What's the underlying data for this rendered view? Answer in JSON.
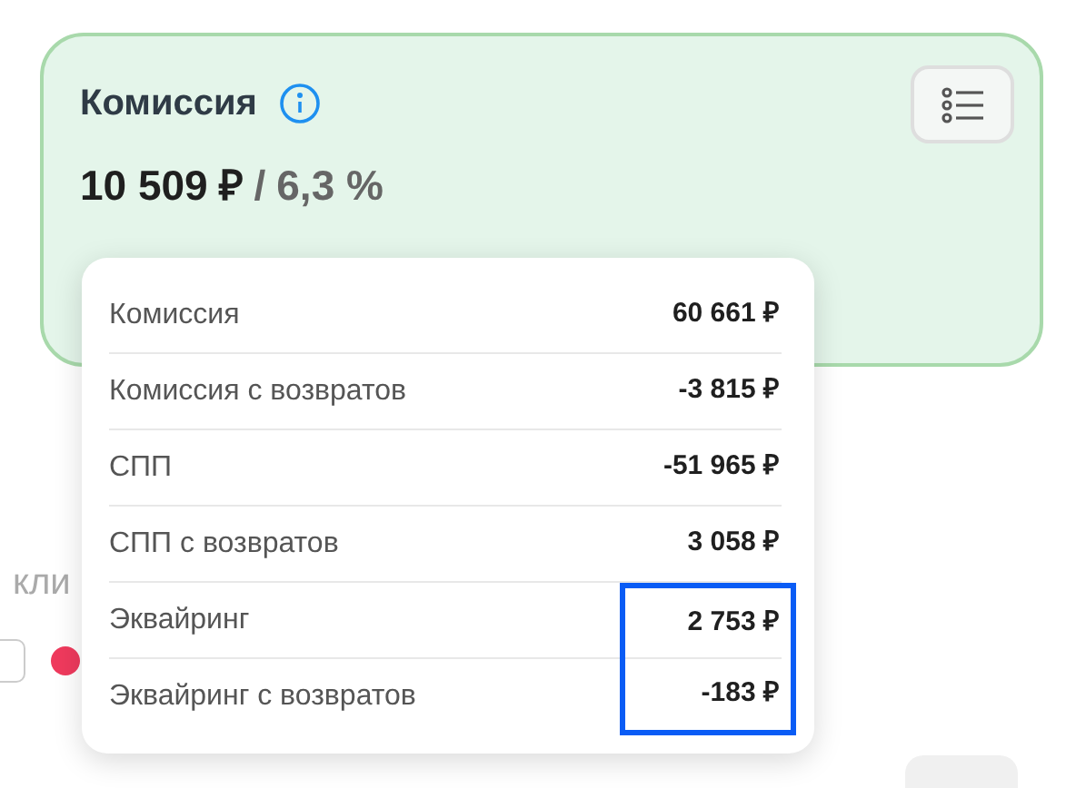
{
  "card": {
    "title": "Комиссия",
    "amount": "10 509 ₽",
    "separator": "/",
    "percent": "6,3 %"
  },
  "background": {
    "text": "кли",
    "checkbox_checked": false
  },
  "breakdown": [
    {
      "label": "Комиссия",
      "value": "60 661 ₽",
      "highlighted": false
    },
    {
      "label": "Комиссия с возвратов",
      "value": "-3 815 ₽",
      "highlighted": false
    },
    {
      "label": "СПП",
      "value": "-51 965 ₽",
      "highlighted": false
    },
    {
      "label": "СПП с возвратов",
      "value": "3 058 ₽",
      "highlighted": false
    },
    {
      "label": "Эквайринг",
      "value": "2 753 ₽",
      "highlighted": true
    },
    {
      "label": "Эквайринг с возвратов",
      "value": "-183 ₽",
      "highlighted": true
    }
  ]
}
